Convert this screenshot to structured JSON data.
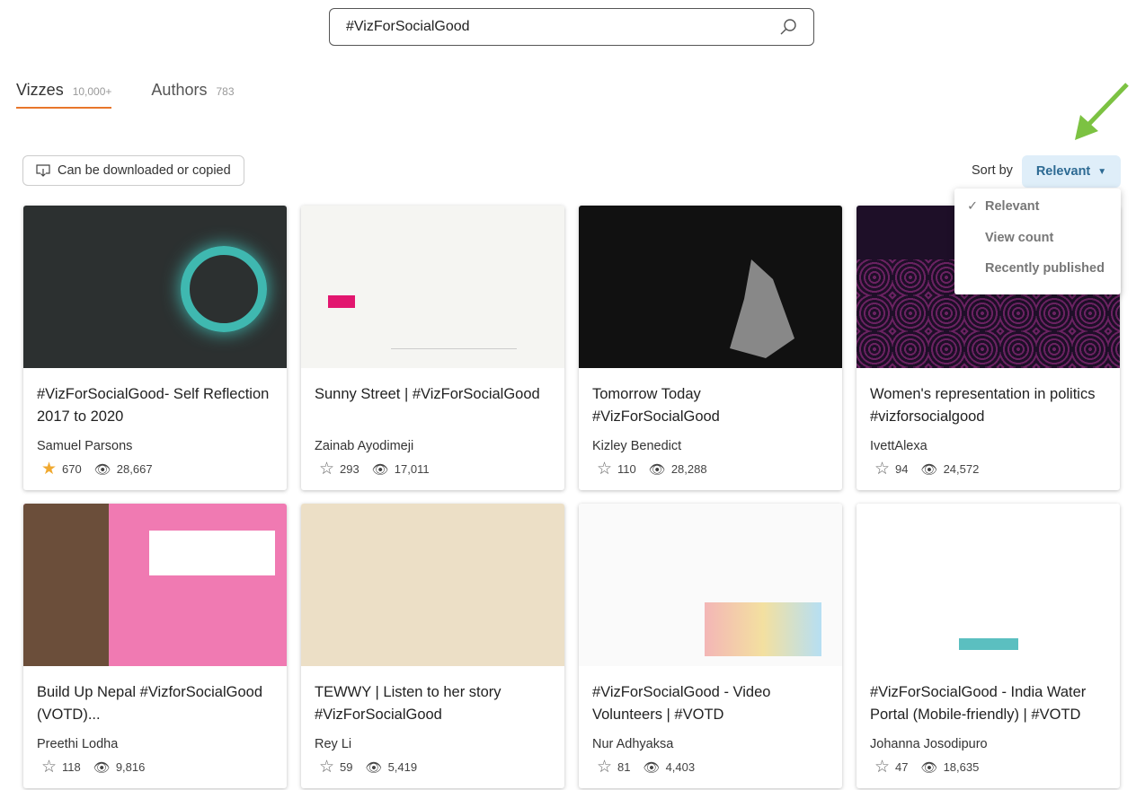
{
  "search": {
    "value": "#VizForSocialGood"
  },
  "tabs": [
    {
      "label": "Vizzes",
      "count": "10,000+"
    },
    {
      "label": "Authors",
      "count": "783"
    }
  ],
  "filter": {
    "label": "Can be downloaded or copied"
  },
  "sort": {
    "label": "Sort by",
    "selected": "Relevant",
    "options": [
      "Relevant",
      "View count",
      "Recently published"
    ]
  },
  "accent": "#e8762b",
  "cards": [
    {
      "title": "#VizForSocialGood- Self Reflection 2017 to 2020",
      "author": "Samuel Parsons",
      "favorites": "670",
      "views": "28,667",
      "favorited": true,
      "bg": "#2c3030"
    },
    {
      "title": "Sunny Street | #VizForSocialGood",
      "author": "Zainab Ayodimeji",
      "favorites": "293",
      "views": "17,011",
      "bg": "#f5f5f2"
    },
    {
      "title": "Tomorrow Today #VizForSocialGood",
      "author": "Kizley Benedict",
      "favorites": "110",
      "views": "28,288",
      "bg": "#111111"
    },
    {
      "title": "Women's representation in politics #vizforsocialgood",
      "author": "IvettAlexa",
      "favorites": "94",
      "views": "24,572",
      "bg": "#1e0f28"
    },
    {
      "title": "Build Up Nepal #VizforSocialGood (VOTD)...",
      "author": "Preethi Lodha",
      "favorites": "118",
      "views": "9,816",
      "bg": "#f07ab2"
    },
    {
      "title": "TEWWY | Listen to her story #VizForSocialGood",
      "author": "Rey Li",
      "favorites": "59",
      "views": "5,419",
      "bg": "#ecdfc6"
    },
    {
      "title": "#VizForSocialGood - Video Volunteers | #VOTD",
      "author": "Nur Adhyaksa",
      "favorites": "81",
      "views": "4,403",
      "bg": "#fafafa"
    },
    {
      "title": "#VizForSocialGood - India Water Portal (Mobile-friendly) | #VOTD",
      "author": "Johanna Josodipuro",
      "favorites": "47",
      "views": "18,635",
      "bg": "#ffffff"
    }
  ]
}
